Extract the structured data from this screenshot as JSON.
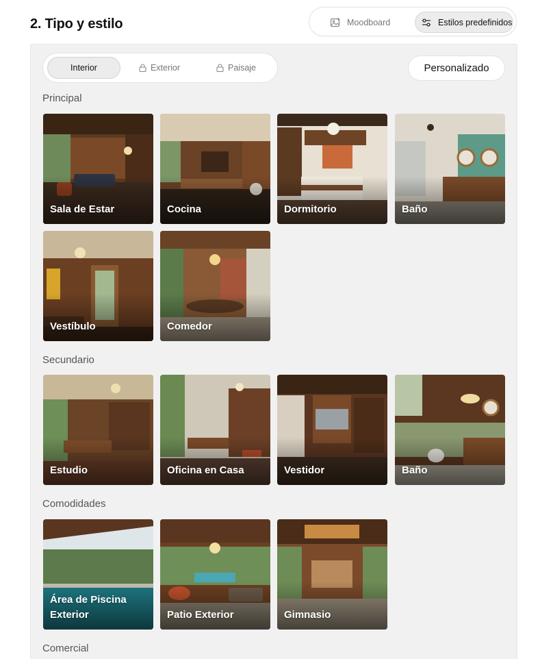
{
  "header": {
    "title": "2. Tipo y estilo",
    "mode_options": [
      {
        "label": "Moodboard",
        "icon": "image-plus-icon",
        "selected": false
      },
      {
        "label": "Estilos predefinidos",
        "icon": "sliders-icon",
        "selected": true
      }
    ]
  },
  "panel": {
    "tabs": [
      {
        "label": "Interior",
        "locked": false,
        "selected": true
      },
      {
        "label": "Exterior",
        "locked": true,
        "selected": false,
        "icon": "lock-icon"
      },
      {
        "label": "Paisaje",
        "locked": true,
        "selected": false,
        "icon": "lock-icon"
      }
    ],
    "custom_button": "Personalizado",
    "sections": [
      {
        "title": "Principal",
        "items": [
          "Sala de Estar",
          "Cocina",
          "Dormitorio",
          "Baño",
          "Vestíbulo",
          "Comedor"
        ]
      },
      {
        "title": "Secundario",
        "items": [
          "Estudio",
          "Oficina en Casa",
          "Vestidor",
          "Baño"
        ]
      },
      {
        "title": "Comodidades",
        "items": [
          "Área de Piscina Exterior",
          "Patio Exterior",
          "Gimnasio"
        ]
      },
      {
        "title": "Comercial",
        "items": []
      }
    ]
  },
  "colors": {
    "panel_bg": "#f1f1f1",
    "wood": "#6b3f22",
    "accent_selected": "#ececec"
  }
}
